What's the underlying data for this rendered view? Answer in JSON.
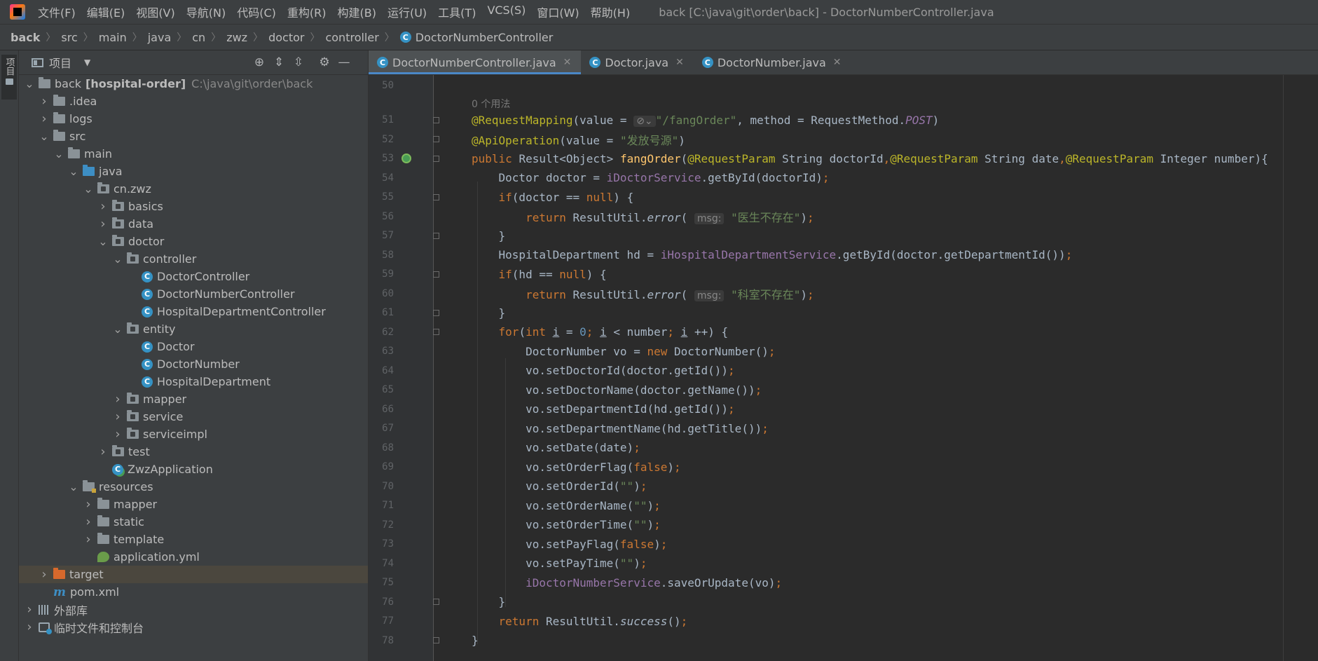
{
  "menubar": {
    "items": [
      "文件(F)",
      "编辑(E)",
      "视图(V)",
      "导航(N)",
      "代码(C)",
      "重构(R)",
      "构建(B)",
      "运行(U)",
      "工具(T)",
      "VCS(S)",
      "窗口(W)",
      "帮助(H)"
    ],
    "window_title": "back [C:\\java\\git\\order\\back] - DoctorNumberController.java"
  },
  "breadcrumb": [
    "back",
    "src",
    "main",
    "java",
    "cn",
    "zwz",
    "doctor",
    "controller",
    "DoctorNumberController"
  ],
  "left_stripe": {
    "project_label": "项目"
  },
  "project_panel": {
    "title": "项目",
    "tree": [
      {
        "name": "back",
        "bold_suffix": "[hospital-order]",
        "path": "C:\\java\\git\\order\\back",
        "depth": 0,
        "arrow": "down",
        "icon": "folder"
      },
      {
        "name": ".idea",
        "depth": 1,
        "arrow": "right",
        "icon": "folder"
      },
      {
        "name": "logs",
        "depth": 1,
        "arrow": "right",
        "icon": "folder"
      },
      {
        "name": "src",
        "depth": 1,
        "arrow": "down",
        "icon": "folder"
      },
      {
        "name": "main",
        "depth": 2,
        "arrow": "down",
        "icon": "folder"
      },
      {
        "name": "java",
        "depth": 3,
        "arrow": "down",
        "icon": "folder-blue"
      },
      {
        "name": "cn.zwz",
        "depth": 4,
        "arrow": "down",
        "icon": "package"
      },
      {
        "name": "basics",
        "depth": 5,
        "arrow": "right",
        "icon": "package"
      },
      {
        "name": "data",
        "depth": 5,
        "arrow": "right",
        "icon": "package"
      },
      {
        "name": "doctor",
        "depth": 5,
        "arrow": "down",
        "icon": "package"
      },
      {
        "name": "controller",
        "depth": 6,
        "arrow": "down",
        "icon": "package"
      },
      {
        "name": "DoctorController",
        "depth": 7,
        "arrow": "none",
        "icon": "class"
      },
      {
        "name": "DoctorNumberController",
        "depth": 7,
        "arrow": "none",
        "icon": "class"
      },
      {
        "name": "HospitalDepartmentController",
        "depth": 7,
        "arrow": "none",
        "icon": "class"
      },
      {
        "name": "entity",
        "depth": 6,
        "arrow": "down",
        "icon": "package"
      },
      {
        "name": "Doctor",
        "depth": 7,
        "arrow": "none",
        "icon": "class"
      },
      {
        "name": "DoctorNumber",
        "depth": 7,
        "arrow": "none",
        "icon": "class"
      },
      {
        "name": "HospitalDepartment",
        "depth": 7,
        "arrow": "none",
        "icon": "class"
      },
      {
        "name": "mapper",
        "depth": 6,
        "arrow": "right",
        "icon": "package"
      },
      {
        "name": "service",
        "depth": 6,
        "arrow": "right",
        "icon": "package"
      },
      {
        "name": "serviceimpl",
        "depth": 6,
        "arrow": "right",
        "icon": "package"
      },
      {
        "name": "test",
        "depth": 5,
        "arrow": "right",
        "icon": "package"
      },
      {
        "name": "ZwzApplication",
        "depth": 5,
        "arrow": "none",
        "icon": "app"
      },
      {
        "name": "resources",
        "depth": 3,
        "arrow": "down",
        "icon": "folder-res"
      },
      {
        "name": "mapper",
        "depth": 4,
        "arrow": "right",
        "icon": "folder"
      },
      {
        "name": "static",
        "depth": 4,
        "arrow": "right",
        "icon": "folder"
      },
      {
        "name": "template",
        "depth": 4,
        "arrow": "right",
        "icon": "folder"
      },
      {
        "name": "application.yml",
        "depth": 4,
        "arrow": "none",
        "icon": "yml"
      },
      {
        "name": "target",
        "depth": 1,
        "arrow": "right",
        "icon": "folder-orange",
        "selected": true
      },
      {
        "name": "pom.xml",
        "depth": 1,
        "arrow": "none",
        "icon": "pom"
      },
      {
        "name": "外部库",
        "depth": 0,
        "arrow": "right",
        "icon": "lib"
      },
      {
        "name": "临时文件和控制台",
        "depth": 0,
        "arrow": "right",
        "icon": "scratch"
      }
    ]
  },
  "editor": {
    "tabs": [
      {
        "label": "DoctorNumberController.java",
        "active": true
      },
      {
        "label": "Doctor.java",
        "active": false
      },
      {
        "label": "DoctorNumber.java",
        "active": false
      }
    ],
    "usages_hint": "0 个用法",
    "param_hint": "msg:",
    "lines": [
      {
        "n": "50",
        "segs": []
      },
      {
        "n": "51",
        "segs": [
          [
            "ann",
            "@RequestMapping"
          ],
          [
            "",
            "(value = "
          ],
          [
            "hint",
            "⊘⌄"
          ],
          [
            "str",
            "\"/fangOrder\""
          ],
          [
            "",
            ", method = RequestMethod."
          ],
          [
            "fld it",
            "POST"
          ],
          [
            "",
            ")"
          ]
        ]
      },
      {
        "n": "52",
        "segs": [
          [
            "ann",
            "@ApiOperation"
          ],
          [
            "",
            "(value = "
          ],
          [
            "str",
            "\"发放号源\""
          ],
          [
            "",
            ")"
          ]
        ]
      },
      {
        "n": "53",
        "segs": [
          [
            "kw",
            "public "
          ],
          [
            "",
            "Result<Object> "
          ],
          [
            "fn",
            "fangOrder"
          ],
          [
            "",
            "("
          ],
          [
            "ann",
            "@RequestParam "
          ],
          [
            "",
            "String doctorId"
          ],
          [
            "kw",
            ","
          ],
          [
            "ann",
            "@RequestParam "
          ],
          [
            "",
            "String date"
          ],
          [
            "kw",
            ","
          ],
          [
            "ann",
            "@RequestParam "
          ],
          [
            "",
            "Integer number){"
          ]
        ]
      },
      {
        "n": "54",
        "segs": [
          [
            "",
            "    Doctor doctor = "
          ],
          [
            "fld",
            "iDoctorService"
          ],
          [
            "",
            ".getById(doctorId)"
          ],
          [
            "kw",
            ";"
          ]
        ]
      },
      {
        "n": "55",
        "segs": [
          [
            "kw",
            "    if"
          ],
          [
            "",
            "(doctor == "
          ],
          [
            "kw",
            "null"
          ],
          [
            "",
            ") {"
          ]
        ]
      },
      {
        "n": "56",
        "segs": [
          [
            "kw",
            "        return "
          ],
          [
            "",
            "ResultUtil."
          ],
          [
            "it",
            "error"
          ],
          [
            "",
            "( "
          ],
          [
            "hint",
            "msg:"
          ],
          [
            "str",
            " \"医生不存在\""
          ],
          [
            "",
            ")"
          ],
          [
            "kw",
            ";"
          ]
        ]
      },
      {
        "n": "57",
        "segs": [
          [
            "",
            "    }"
          ]
        ]
      },
      {
        "n": "58",
        "segs": [
          [
            "",
            "    HospitalDepartment hd = "
          ],
          [
            "fld",
            "iHospitalDepartmentService"
          ],
          [
            "",
            ".getById(doctor.getDepartmentId())"
          ],
          [
            "kw",
            ";"
          ]
        ]
      },
      {
        "n": "59",
        "segs": [
          [
            "kw",
            "    if"
          ],
          [
            "",
            "(hd == "
          ],
          [
            "kw",
            "null"
          ],
          [
            "",
            ") {"
          ]
        ]
      },
      {
        "n": "60",
        "segs": [
          [
            "kw",
            "        return "
          ],
          [
            "",
            "ResultUtil."
          ],
          [
            "it",
            "error"
          ],
          [
            "",
            "( "
          ],
          [
            "hint",
            "msg:"
          ],
          [
            "str",
            " \"科室不存在\""
          ],
          [
            "",
            ")"
          ],
          [
            "kw",
            ";"
          ]
        ]
      },
      {
        "n": "61",
        "segs": [
          [
            "",
            "    }"
          ]
        ]
      },
      {
        "n": "62",
        "segs": [
          [
            "kw",
            "    for"
          ],
          [
            "",
            "("
          ],
          [
            "kw",
            "int "
          ],
          [
            "ul",
            "i"
          ],
          [
            "",
            " = "
          ],
          [
            "num",
            "0"
          ],
          [
            "kw",
            "; "
          ],
          [
            "ul",
            "i"
          ],
          [
            "",
            " < number"
          ],
          [
            "kw",
            "; "
          ],
          [
            "ul",
            "i"
          ],
          [
            "",
            " ++) {"
          ]
        ]
      },
      {
        "n": "63",
        "segs": [
          [
            "",
            "        DoctorNumber vo = "
          ],
          [
            "kw",
            "new "
          ],
          [
            "",
            "DoctorNumber()"
          ],
          [
            "kw",
            ";"
          ]
        ]
      },
      {
        "n": "64",
        "segs": [
          [
            "",
            "        vo.setDoctorId(doctor.getId())"
          ],
          [
            "kw",
            ";"
          ]
        ]
      },
      {
        "n": "65",
        "segs": [
          [
            "",
            "        vo.setDoctorName(doctor.getName())"
          ],
          [
            "kw",
            ";"
          ]
        ]
      },
      {
        "n": "66",
        "segs": [
          [
            "",
            "        vo.setDepartmentId(hd.getId())"
          ],
          [
            "kw",
            ";"
          ]
        ]
      },
      {
        "n": "67",
        "segs": [
          [
            "",
            "        vo.setDepartmentName(hd.getTitle())"
          ],
          [
            "kw",
            ";"
          ]
        ]
      },
      {
        "n": "68",
        "segs": [
          [
            "",
            "        vo.setDate(date)"
          ],
          [
            "kw",
            ";"
          ]
        ]
      },
      {
        "n": "69",
        "segs": [
          [
            "",
            "        vo.setOrderFlag("
          ],
          [
            "kw",
            "false"
          ],
          [
            "",
            ")"
          ],
          [
            "kw",
            ";"
          ]
        ]
      },
      {
        "n": "70",
        "segs": [
          [
            "",
            "        vo.setOrderId("
          ],
          [
            "str",
            "\"\""
          ],
          [
            "",
            ")"
          ],
          [
            "kw",
            ";"
          ]
        ]
      },
      {
        "n": "71",
        "segs": [
          [
            "",
            "        vo.setOrderName("
          ],
          [
            "str",
            "\"\""
          ],
          [
            "",
            ")"
          ],
          [
            "kw",
            ";"
          ]
        ]
      },
      {
        "n": "72",
        "segs": [
          [
            "",
            "        vo.setOrderTime("
          ],
          [
            "str",
            "\"\""
          ],
          [
            "",
            ")"
          ],
          [
            "kw",
            ";"
          ]
        ]
      },
      {
        "n": "73",
        "segs": [
          [
            "",
            "        vo.setPayFlag("
          ],
          [
            "kw",
            "false"
          ],
          [
            "",
            ")"
          ],
          [
            "kw",
            ";"
          ]
        ]
      },
      {
        "n": "74",
        "segs": [
          [
            "",
            "        vo.setPayTime("
          ],
          [
            "str",
            "\"\""
          ],
          [
            "",
            ")"
          ],
          [
            "kw",
            ";"
          ]
        ]
      },
      {
        "n": "75",
        "segs": [
          [
            "fld",
            "        iDoctorNumberService"
          ],
          [
            "",
            ".saveOrUpdate(vo)"
          ],
          [
            "kw",
            ";"
          ]
        ]
      },
      {
        "n": "76",
        "segs": [
          [
            "",
            "    }"
          ]
        ]
      },
      {
        "n": "77",
        "segs": [
          [
            "kw",
            "    return "
          ],
          [
            "",
            "ResultUtil."
          ],
          [
            "it",
            "success"
          ],
          [
            "",
            "()"
          ],
          [
            "kw",
            ";"
          ]
        ]
      },
      {
        "n": "78",
        "segs": [
          [
            "",
            "}"
          ]
        ]
      }
    ]
  },
  "colors": {
    "background": "#2b2b2b",
    "panel": "#3c3f41",
    "keyword": "#cc7832",
    "annotation": "#bbb529",
    "string": "#6a8759",
    "field": "#9876aa",
    "number": "#6897bb",
    "method_decl": "#ffc66d",
    "accent": "#4a88c7"
  },
  "icons": {
    "tool_buttons": [
      "locate-icon",
      "expand-all-icon",
      "collapse-all-icon",
      "settings-icon",
      "hide-icon"
    ]
  }
}
